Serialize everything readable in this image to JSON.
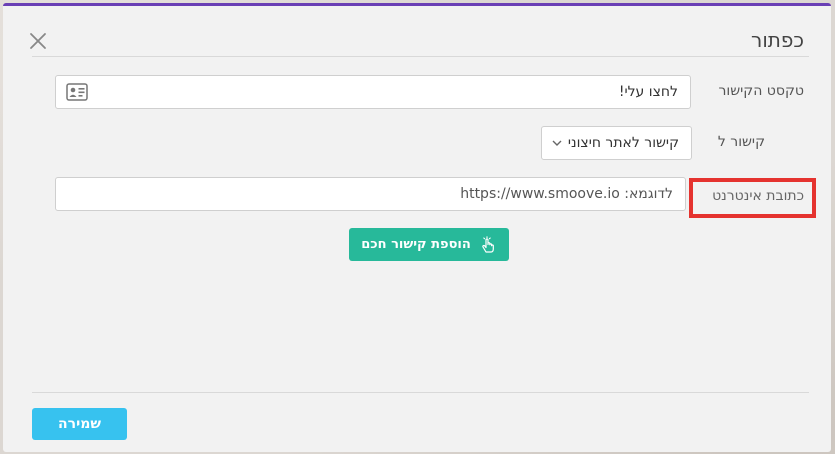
{
  "dialog": {
    "title": "כפתור"
  },
  "form": {
    "link_text_label": "טקסט הקישור",
    "link_text_value": "לחצו עלי!",
    "link_to_label": "קישור ל",
    "link_to_selected": "קישור לאתר חיצוני",
    "url_label": "כתובת אינטרנט",
    "url_placeholder": "לדוגמא: https://www.smoove.io"
  },
  "actions": {
    "smart_link_label": "הוספת קישור חכם",
    "save_label": "שמירה"
  },
  "colors": {
    "accent_top": "#6a3fb5",
    "smart_button": "#27b99a",
    "save_button": "#37c2ef",
    "highlight": "#e5332f"
  },
  "icons": {
    "close": "close-icon",
    "contact_card": "contact-card-icon",
    "chevron": "chevron-down-icon",
    "smart_link": "hand-pointer-icon"
  }
}
